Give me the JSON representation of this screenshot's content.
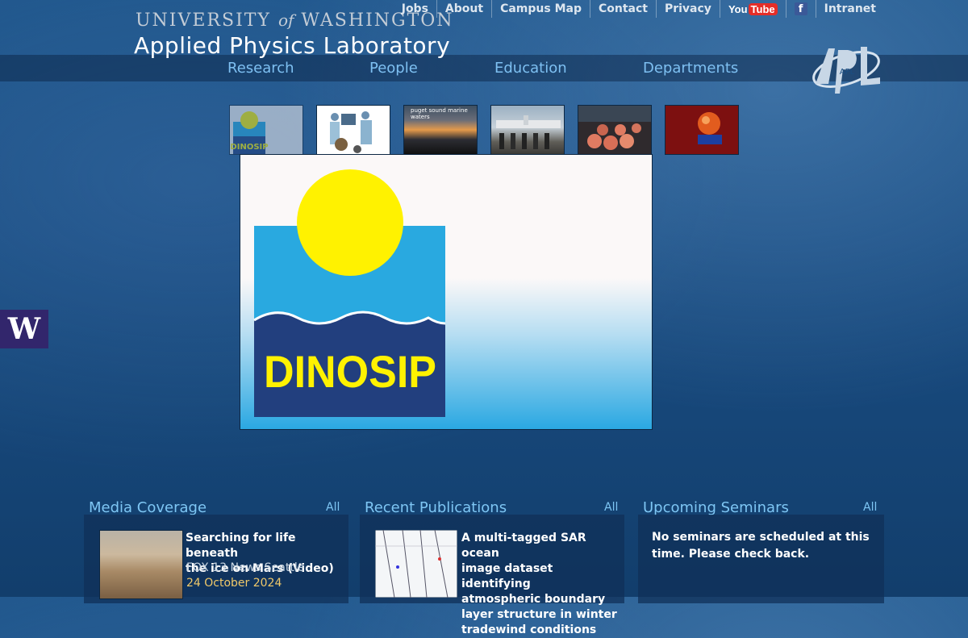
{
  "header": {
    "uw_name_part1": "UNIVERSITY",
    "uw_name_of": "of",
    "uw_name_part2": "WASHINGTON",
    "lab_name": "Applied Physics Laboratory"
  },
  "utility_nav": [
    "Jobs",
    "About",
    "Campus Map",
    "Contact",
    "Privacy",
    "YouTube",
    "Facebook",
    "Intranet"
  ],
  "youtube": {
    "you": "You",
    "tube": "Tube"
  },
  "facebook_glyph": "f",
  "intranet_label": "Intranet",
  "main_nav": [
    "Research",
    "People",
    "Education",
    "Departments"
  ],
  "logo_text": "APL",
  "slideshow": {
    "thumbnails": [
      {
        "name": "dinosip-thumb",
        "caption": "DINOSIP"
      },
      {
        "name": "medical-illustration-thumb",
        "caption": ""
      },
      {
        "name": "puget-sound-thumb",
        "caption": "puget sound marine waters"
      },
      {
        "name": "aircraft-crew-thumb",
        "caption": ""
      },
      {
        "name": "lab-equipment-thumb",
        "caption": ""
      },
      {
        "name": "red-sphere-thumb",
        "caption": ""
      }
    ],
    "active_title": "DINOSIP"
  },
  "uw_tab_letter": "W",
  "media": {
    "heading": "Media Coverage",
    "all_label": "All",
    "item_title_line1": "Searching for life beneath",
    "item_title_line2": "the ice on Mars (Video)",
    "source": "FOX 13 News Seattle",
    "date": "24 October 2024"
  },
  "publications": {
    "heading": "Recent Publications",
    "all_label": "All",
    "lines": [
      "A multi-tagged SAR ocean",
      "image dataset identifying",
      "atmospheric boundary",
      "layer structure in winter",
      "tradewind conditions"
    ]
  },
  "seminars": {
    "heading": "Upcoming Seminars",
    "all_label": "All",
    "line1": "No seminars are scheduled at this",
    "line2": "time. Please check back."
  },
  "colors": {
    "background": "#1a4d82",
    "nav_link": "#7ec0f2",
    "uw_purple": "#32266c",
    "date_gold": "#f0c96a",
    "dinosip_blue": "#29a9e0",
    "dinosip_navy": "#223f7e",
    "dinosip_yellow": "#fff200"
  }
}
